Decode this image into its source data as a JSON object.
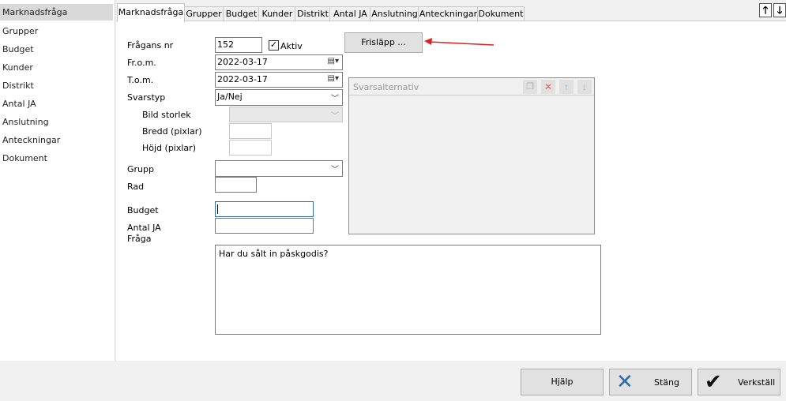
{
  "sidebar": {
    "items": [
      {
        "label": "Marknadsfråga"
      },
      {
        "label": "Grupper"
      },
      {
        "label": "Budget"
      },
      {
        "label": "Kunder"
      },
      {
        "label": "Distrikt"
      },
      {
        "label": "Antal JA"
      },
      {
        "label": "Anslutning"
      },
      {
        "label": "Anteckningar"
      },
      {
        "label": "Dokument"
      }
    ],
    "selected": "Marknadsfråga"
  },
  "tabs": [
    {
      "label": "Marknadsfråga"
    },
    {
      "label": "Grupper"
    },
    {
      "label": "Budget"
    },
    {
      "label": "Kunder"
    },
    {
      "label": "Distrikt"
    },
    {
      "label": "Antal JA"
    },
    {
      "label": "Anslutning"
    },
    {
      "label": "Anteckningar"
    },
    {
      "label": "Dokument"
    }
  ],
  "form": {
    "question_nr_label": "Frågans nr",
    "question_nr": "152",
    "active_label": "Aktiv",
    "active_checked": true,
    "from_label": "Fr.o.m.",
    "from_date": "2022-03-17",
    "to_label": "T.o.m.",
    "to_date": "2022-03-17",
    "answer_type_label": "Svarstyp",
    "answer_type": "Ja/Nej",
    "image_size_label": "Bild storlek",
    "width_label": "Bredd (pixlar)",
    "height_label": "Höjd (pixlar)",
    "group_label": "Grupp",
    "row_label": "Rad",
    "budget_label": "Budget",
    "yes_count_label_1": "Antal JA",
    "yes_count_label_2": "Fråga",
    "question_text": "Har du sålt in påskgodis?",
    "release_button": "Frisläpp ...",
    "options_panel_title": "Svarsalternativ"
  },
  "footer": {
    "help": "Hjälp",
    "close": "Stäng",
    "execute": "Verkställ"
  },
  "colors": {
    "arrow": "#e02020",
    "close_icon": "#2b6cb0",
    "check_icon": "#111111",
    "delete_icon": "#e06060"
  }
}
